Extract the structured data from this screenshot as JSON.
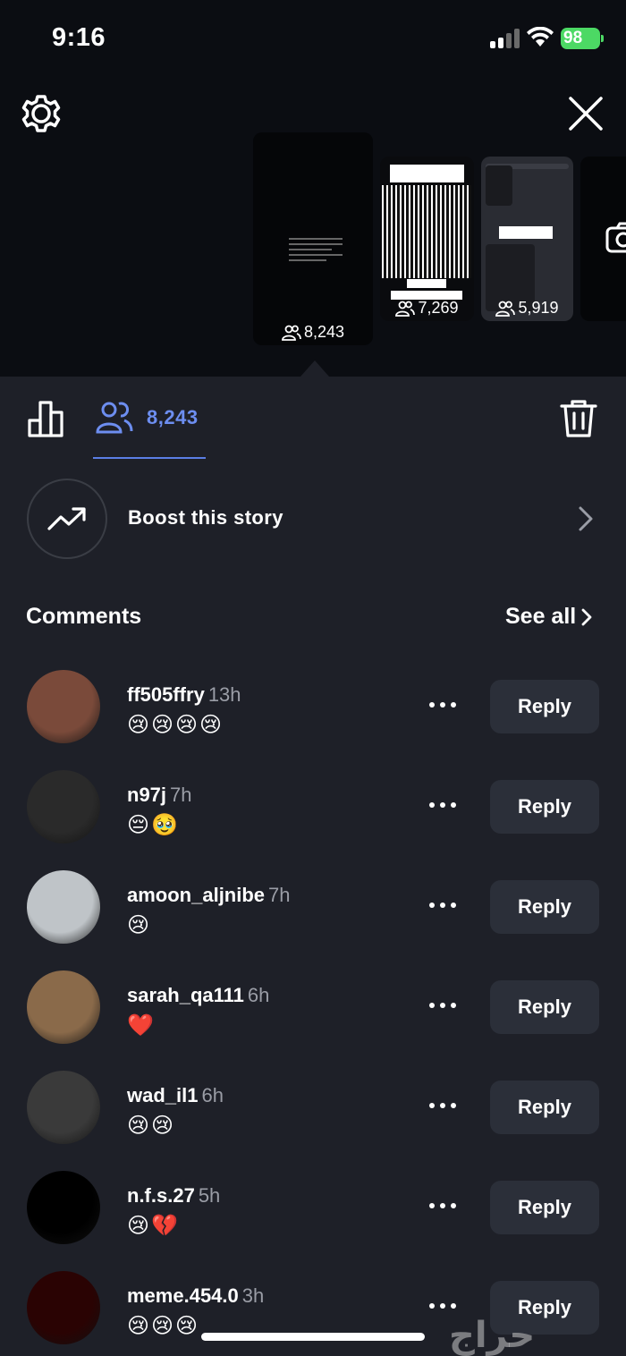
{
  "status_bar": {
    "time": "9:16",
    "battery": "98"
  },
  "story_thumbnails": [
    {
      "count": "8,243"
    },
    {
      "count": "7,269"
    },
    {
      "count": "5,919"
    }
  ],
  "tabs": {
    "viewers_count": "8,243"
  },
  "boost": {
    "label": "Boost this story"
  },
  "comments_section": {
    "title": "Comments",
    "see_all": "See all"
  },
  "comments": [
    {
      "username": "ff505ffry",
      "time": "13h",
      "text": "😢😢😢😢",
      "reply": "Reply",
      "avatar_color": "#7a4a3a"
    },
    {
      "username": "n97j",
      "time": "7h",
      "text": "😔🥹",
      "reply": "Reply",
      "avatar_color": "#2a2a2a"
    },
    {
      "username": "amoon_aljnibe",
      "time": "7h",
      "text": "😢",
      "reply": "Reply",
      "avatar_color": "#bfc4c8"
    },
    {
      "username": "sarah_qa111",
      "time": "6h",
      "text": "❤️",
      "reply": "Reply",
      "avatar_color": "#8a6a4a"
    },
    {
      "username": "wad_il1",
      "time": "6h",
      "text": "😢😢",
      "reply": "Reply",
      "avatar_color": "#3a3a3a"
    },
    {
      "username": "n.f.s.27",
      "time": "5h",
      "text": "😢💔",
      "reply": "Reply",
      "avatar_color": "#000000"
    },
    {
      "username": "meme.454.0",
      "time": "3h",
      "text": "😢😢😢",
      "reply": "Reply",
      "avatar_color": "#2a0303"
    }
  ],
  "watermark": "حراج",
  "colors": {
    "accent": "#6d8ef0",
    "background": "#1e2028",
    "top_background": "#0b0d12",
    "button_bg": "#2b2f39"
  }
}
